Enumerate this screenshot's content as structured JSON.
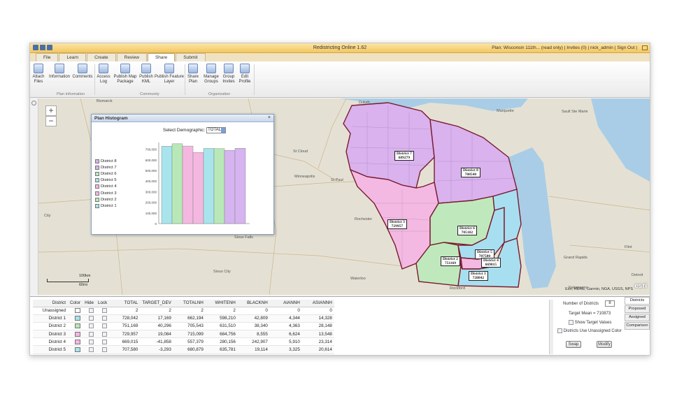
{
  "window": {
    "title": "Redistricting Online 1.62",
    "right_text": "Plan: Wisconsin 111th... (read only)  |  Invites (0)  |  nick_admin  |  Sign Out  |"
  },
  "tabs": [
    "File",
    "Learn",
    "Create",
    "Review",
    "Share",
    "Submit"
  ],
  "ribbon": {
    "buttons": [
      {
        "label": "Attach\nFiles",
        "icon": "paperclip-icon"
      },
      {
        "label": "Information",
        "icon": "document-icon"
      },
      {
        "label": "Comments",
        "icon": "comment-icon"
      },
      {
        "label": "Access\nLog",
        "icon": "table-icon"
      },
      {
        "label": "Publish Map\nPackage",
        "icon": "map-package-icon"
      },
      {
        "label": "Publish\nKML",
        "icon": "kml-icon"
      },
      {
        "label": "Publish Feature\nLayer",
        "icon": "layer-icon"
      },
      {
        "label": "Share\nPlan",
        "icon": "share-icon"
      },
      {
        "label": "Manage\nGroups",
        "icon": "groups-icon"
      },
      {
        "label": "Group\nInvites",
        "icon": "invite-icon"
      },
      {
        "label": "Edit\nProfile",
        "icon": "edit-profile-icon"
      }
    ],
    "groups": [
      "Plan Information",
      "Community",
      "Organization"
    ]
  },
  "map": {
    "cities": [
      "Bismarck",
      "Duluth",
      "Marquette",
      "Sault Ste Marie",
      "St Cloud",
      "Minneapolis",
      "St Paul",
      "Rochester",
      "Sioux Falls",
      "Sioux City",
      "Waterloo",
      "Rockford",
      "Waukegan",
      "Grand Rapids",
      "Kalamazoo",
      "Flint",
      "Detroit",
      "City"
    ],
    "district_labels": [
      {
        "name": "District 7",
        "value": "689279"
      },
      {
        "name": "District 8",
        "value": "708540"
      },
      {
        "name": "District 3",
        "value": "729957"
      },
      {
        "name": "District 6",
        "value": "705102"
      },
      {
        "name": "District 5",
        "value": "707580"
      },
      {
        "name": "District 2",
        "value": "751169"
      },
      {
        "name": "District 4",
        "value": "669015"
      },
      {
        "name": "District 1",
        "value": "728042"
      }
    ],
    "scale": {
      "km": "100km",
      "mi": "60mi"
    },
    "attribution": "Esri, HERE, Garmin, NGA, USGS, NPS",
    "logo": "esri"
  },
  "histogram": {
    "title": "Plan Histogram",
    "select_label": "Select Demographic:",
    "select_value": "TOTAL",
    "legend": [
      {
        "name": "District 8",
        "color": "#d6b4f0"
      },
      {
        "name": "District 7",
        "color": "#d6b4f0"
      },
      {
        "name": "District 6",
        "color": "#b8e8b8"
      },
      {
        "name": "District 5",
        "color": "#a8e4ec"
      },
      {
        "name": "District 4",
        "color": "#f4b8e0"
      },
      {
        "name": "District 3",
        "color": "#f4b8e0"
      },
      {
        "name": "District 2",
        "color": "#b8e8b8"
      },
      {
        "name": "District 1",
        "color": "#a8e4ec"
      }
    ]
  },
  "chart_data": {
    "type": "bar",
    "categories": [
      "District 1",
      "District 2",
      "District 3",
      "District 4",
      "District 5",
      "District 6",
      "District 7",
      "District 8"
    ],
    "values": [
      728042,
      751169,
      729957,
      669015,
      707580,
      705102,
      689279,
      708540
    ],
    "colors": [
      "#a8e4ec",
      "#b8e8b8",
      "#f4b8e0",
      "#f4b8e0",
      "#a8e4ec",
      "#b8e8b8",
      "#d6b4f0",
      "#d6b4f0"
    ],
    "yticks": [
      "700,000",
      "600,000",
      "500,000",
      "400,000",
      "300,000",
      "200,000",
      "100,000",
      "0"
    ],
    "ylim": [
      0,
      750000
    ],
    "grid": false
  },
  "table": {
    "headers": [
      "District",
      "Color",
      "Hide",
      "Lock",
      "TOTAL",
      "TARGET_DEV",
      "TOTALNH",
      "WHITENH",
      "BLACKNH",
      "AIANNH",
      "ASIANNH"
    ],
    "rows": [
      {
        "name": "Unassigned",
        "color": "#ffffff",
        "total": "2",
        "dev": "2",
        "totalnh": "2",
        "white": "2",
        "black": "0",
        "aian": "0",
        "asian": "0"
      },
      {
        "name": "District 1",
        "color": "#a8e4ec",
        "total": "728,042",
        "dev": "17,169",
        "totalnh": "662,194",
        "white": "598,210",
        "black": "42,809",
        "aian": "4,344",
        "asian": "14,328"
      },
      {
        "name": "District 2",
        "color": "#b8e8b8",
        "total": "751,169",
        "dev": "40,296",
        "totalnh": "705,543",
        "white": "631,510",
        "black": "38,340",
        "aian": "4,363",
        "asian": "28,148"
      },
      {
        "name": "District 3",
        "color": "#f4b8e0",
        "total": "729,957",
        "dev": "19,084",
        "totalnh": "715,099",
        "white": "684,756",
        "black": "8,555",
        "aian": "6,624",
        "asian": "13,548"
      },
      {
        "name": "District 4",
        "color": "#f4b8e0",
        "total": "669,015",
        "dev": "-41,858",
        "totalnh": "557,379",
        "white": "280,156",
        "black": "242,907",
        "aian": "5,910",
        "asian": "23,314"
      },
      {
        "name": "District 5",
        "color": "#a8e4ec",
        "total": "707,580",
        "dev": "-3,293",
        "totalnh": "680,879",
        "white": "635,781",
        "black": "19,114",
        "aian": "3,325",
        "asian": "20,614"
      }
    ]
  },
  "panel": {
    "num_districts_label": "Number of Districts",
    "num_districts_value": "8",
    "target_mean": "Target Mean = 710873",
    "show_target": "Show Target Values",
    "use_unassigned": "Districts Use Unassigned Color",
    "swap": "Swap",
    "modify": "Modify",
    "side_tabs": [
      "Districts",
      "Proposed",
      "Assigned",
      "Comparison"
    ]
  }
}
